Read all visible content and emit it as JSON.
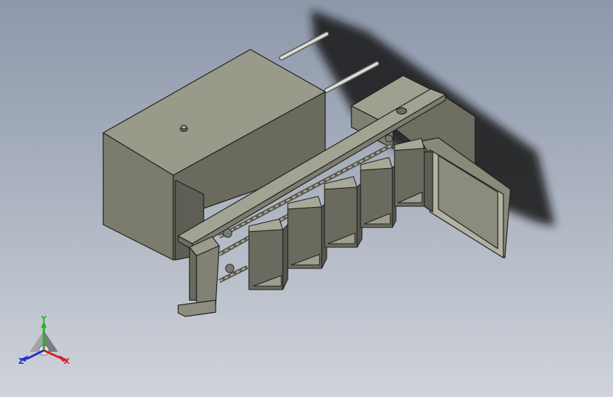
{
  "viewport": {
    "background_top": "#8d98ab",
    "background_bottom": "#cfd3da"
  },
  "model": {
    "parts": [
      "main-housing",
      "guide-rods",
      "top-rail-beam",
      "rear-hopper",
      "open-side-door",
      "bucket-chain",
      "support-leg",
      "cast-shadow"
    ],
    "part_color": "#8a8a7c",
    "bucket_count": 5
  },
  "triad": {
    "x_label": "X",
    "y_label": "Y",
    "z_label": "Z",
    "x_color": "#d42020",
    "y_color": "#2ab02a",
    "z_color": "#2030d0"
  }
}
